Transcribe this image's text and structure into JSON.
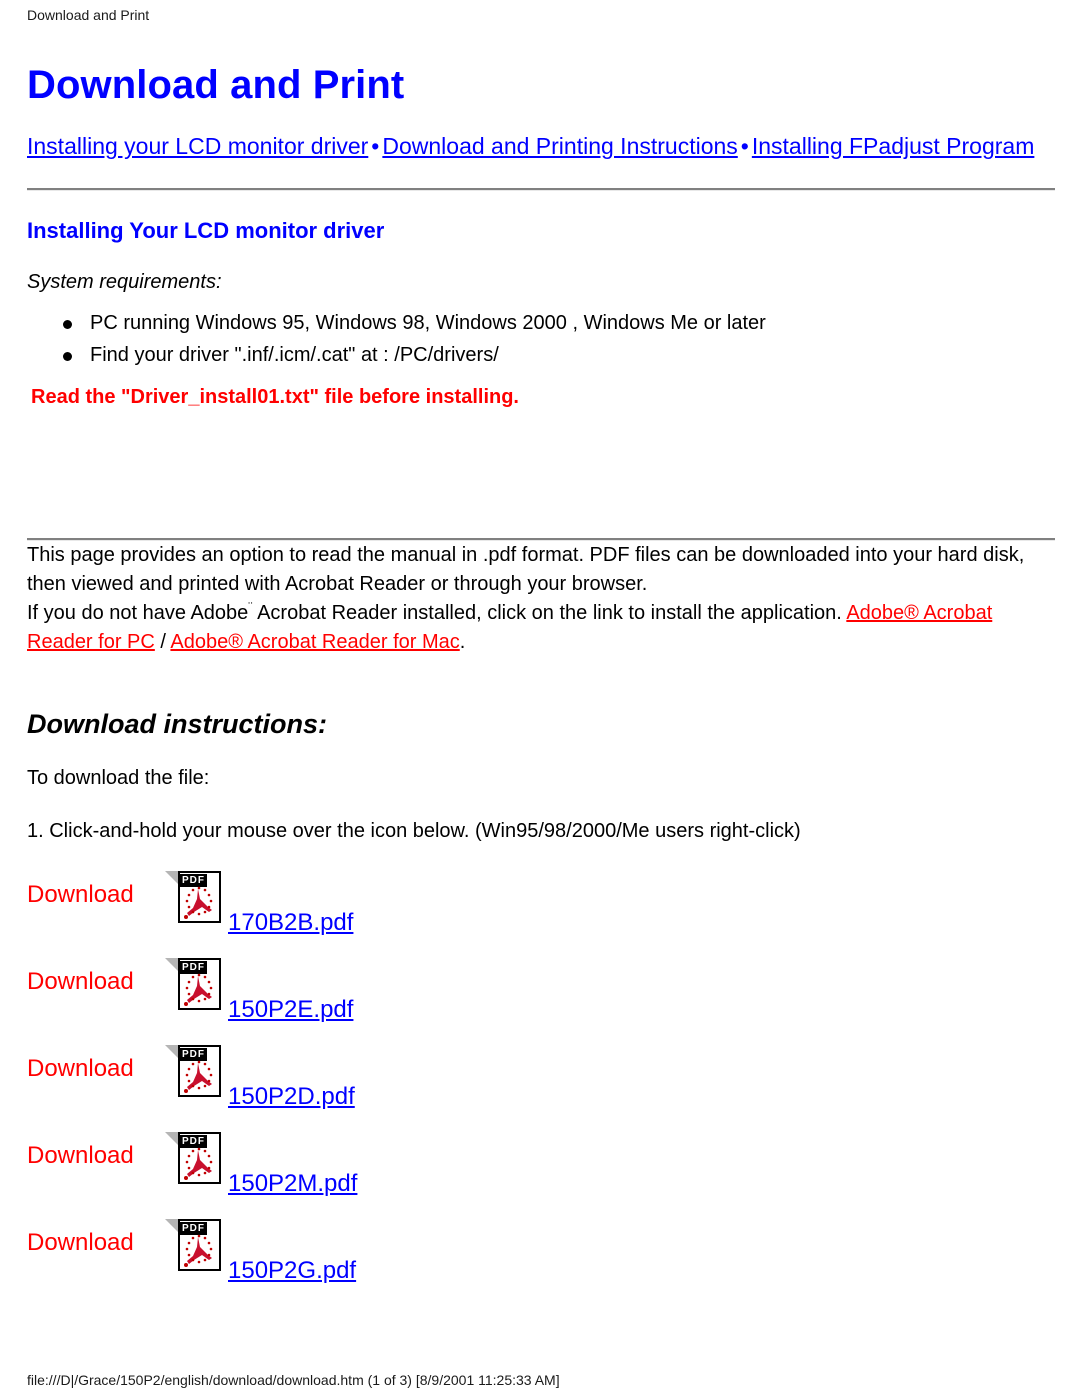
{
  "page_header": "Download and Print",
  "title": "Download and Print",
  "nav": {
    "separator": "•",
    "links": [
      "Installing your LCD monitor driver",
      "Download and Printing Instructions",
      "Installing FPadjust Program"
    ]
  },
  "driver_section": {
    "heading": "Installing Your LCD monitor driver",
    "sys_req_label": "System requirements:",
    "requirements": [
      "PC running Windows 95, Windows 98, Windows 2000 , Windows Me or later",
      "Find your driver \".inf/.icm/.cat\" at : /PC/drivers/"
    ],
    "warning": "Read the \"Driver_install01.txt\" file before installing."
  },
  "pdf_section": {
    "paragraph_1": "This page provides an option to read the manual in .pdf format. PDF files can be downloaded into your hard disk, then viewed and printed with Acrobat Reader or through your browser.",
    "paragraph_2_part_1": "If you do not have Adobe",
    "trademark": "¨",
    "paragraph_2_part_2": " Acrobat Reader installed, click on the link to install the application. ",
    "link_pc": "Adobe® Acrobat Reader for PC",
    "link_divider": " / ",
    "link_mac": "Adobe® Acrobat Reader for Mac",
    "paragraph_2_end": "."
  },
  "instructions": {
    "heading": "Download instructions:",
    "intro": "To download the file:",
    "step_1": "1. Click-and-hold your mouse over the icon below. (Win95/98/2000/Me users right-click)"
  },
  "downloads": {
    "label": "Download",
    "icon_name": "pdf-file-icon",
    "icon_badge": "PDF",
    "items": [
      {
        "label": "Download",
        "file": "170B2B.pdf"
      },
      {
        "label": "Download",
        "file": "150P2E.pdf"
      },
      {
        "label": "Download",
        "file": "150P2D.pdf"
      },
      {
        "label": "Download",
        "file": "150P2M.pdf"
      },
      {
        "label": "Download",
        "file": "150P2G.pdf"
      }
    ]
  },
  "footer": "file:///D|/Grace/150P2/english/download/download.htm (1 of 3) [8/9/2001 11:25:33 AM]",
  "colors": {
    "link_blue": "#0000ff",
    "warning_red": "#ff0000",
    "text_black": "#000000",
    "rule_grey": "#808080"
  }
}
